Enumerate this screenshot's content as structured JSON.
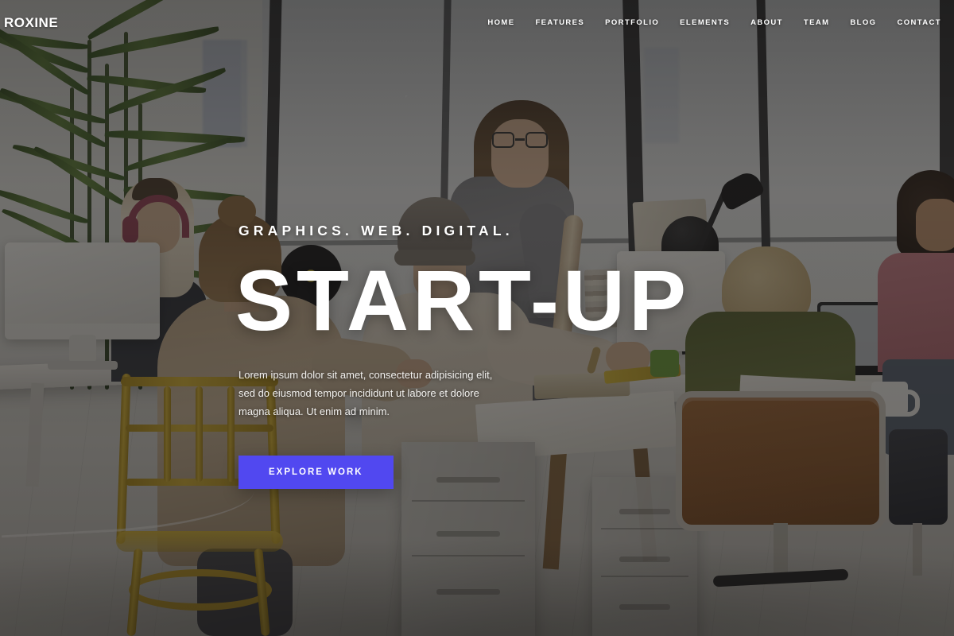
{
  "header": {
    "logo": "ROXINE",
    "nav": [
      {
        "label": "HOME"
      },
      {
        "label": "FEATURES"
      },
      {
        "label": "PORTFOLIO"
      },
      {
        "label": "ELEMENTS"
      },
      {
        "label": "ABOUT"
      },
      {
        "label": "TEAM"
      },
      {
        "label": "BLOG"
      },
      {
        "label": "CONTACT"
      }
    ]
  },
  "hero": {
    "eyebrow": "GRAPHICS. WEB. DIGITAL.",
    "headline": "START-UP",
    "lead": "Lorem ipsum dolor sit amet, consectetur adipisicing elit, sed do eiusmod tempor incididunt ut labore et dolore magna aliqua. Ut enim ad minim.",
    "cta_label": "EXPLORE WORK",
    "cta_color": "#5148f0",
    "text_color": "#ffffff",
    "overlay_color": "rgba(24,21,19,0.50)",
    "background_description": "Open-plan office with floor-to-ceiling windows, team of designers working at shared wooden desks"
  }
}
